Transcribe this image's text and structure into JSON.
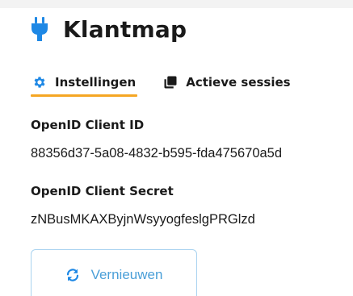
{
  "header": {
    "title": "Klantmap",
    "icon": "plug-icon"
  },
  "tabs": [
    {
      "label": "Instellingen",
      "icon": "gear-icon",
      "active": true
    },
    {
      "label": "Actieve sessies",
      "icon": "copy-icon",
      "active": false
    }
  ],
  "fields": {
    "client_id": {
      "label": "OpenID Client ID",
      "value": "88356d37-5a08-4832-b595-fda475670a5d"
    },
    "client_secret": {
      "label": "OpenID Client Secret",
      "value": "zNBusMKAXByjnWsyyogfeslgPRGlzd"
    }
  },
  "refresh_button": {
    "label": "Vernieuwen",
    "icon": "refresh-icon"
  },
  "colors": {
    "accent": "#f5a623",
    "primary_blue": "#1e88e5",
    "link_blue": "#4a9fd8",
    "button_border": "#a9d3f0",
    "text": "#1a1a1a"
  }
}
